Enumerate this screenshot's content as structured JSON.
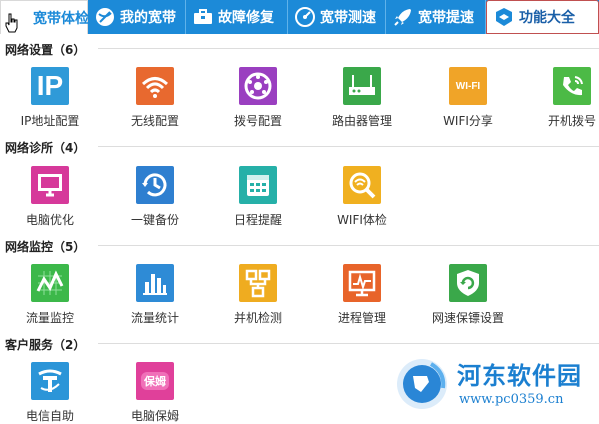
{
  "tabs": [
    {
      "label": "宽带体检",
      "icon": "broadband-check-icon"
    },
    {
      "label": "我的宽带",
      "icon": "globe-icon"
    },
    {
      "label": "故障修复",
      "icon": "toolbox-icon"
    },
    {
      "label": "宽带测速",
      "icon": "speedometer-icon"
    },
    {
      "label": "宽带提速",
      "icon": "rocket-icon"
    },
    {
      "label": "功能大全",
      "icon": "grid-cube-icon"
    }
  ],
  "sections": {
    "network_settings": {
      "title": "网络设置（6）",
      "items": [
        {
          "label": "IP地址配置",
          "icon": "ip-icon",
          "icon_text": "IP",
          "color": "#2f9ad8"
        },
        {
          "label": "无线配置",
          "icon": "wifi-icon",
          "color": "#e8692f"
        },
        {
          "label": "拨号配置",
          "icon": "rotary-phone-icon",
          "color": "#9a3fc0"
        },
        {
          "label": "路由器管理",
          "icon": "router-icon",
          "color": "#3aa84a"
        },
        {
          "label": "WIFI分享",
          "icon": "wifi-share-icon",
          "icon_text": "WI-FI",
          "color": "#f0a428"
        },
        {
          "label": "开机拨号",
          "icon": "phone-icon",
          "color": "#4cba46"
        }
      ]
    },
    "network_diagnosis": {
      "title": "网络诊所（4）",
      "items": [
        {
          "label": "电脑优化",
          "icon": "monitor-icon",
          "color": "#d6399a"
        },
        {
          "label": "一键备份",
          "icon": "backup-clock-icon",
          "color": "#2e7fd0"
        },
        {
          "label": "日程提醒",
          "icon": "calendar-icon",
          "color": "#26b0a8"
        },
        {
          "label": "WIFI体检",
          "icon": "wifi-search-icon",
          "color": "#f0b020"
        }
      ]
    },
    "network_monitor": {
      "title": "网络监控（5）",
      "items": [
        {
          "label": "流量监控",
          "icon": "traffic-graph-icon",
          "color": "#3cb84a"
        },
        {
          "label": "流量统计",
          "icon": "bar-chart-icon",
          "color": "#2e8bd6"
        },
        {
          "label": "并机检测",
          "icon": "network-nodes-icon",
          "color": "#efac20"
        },
        {
          "label": "进程管理",
          "icon": "process-monitor-icon",
          "color": "#e8642a"
        },
        {
          "label": "网速保镖设置",
          "icon": "shield-refresh-icon",
          "color": "#3aa84a"
        }
      ]
    },
    "customer_service": {
      "title": "客户服务（2）",
      "items": [
        {
          "label": "电信自助",
          "icon": "telecom-logo-icon",
          "color": "#2b95d8"
        },
        {
          "label": "电脑保姆",
          "icon": "nanny-icon",
          "icon_text": "保姆",
          "color": "#e0409a"
        }
      ]
    }
  },
  "watermark": {
    "name": "河东软件园",
    "url": "www.pc0359.cn"
  }
}
